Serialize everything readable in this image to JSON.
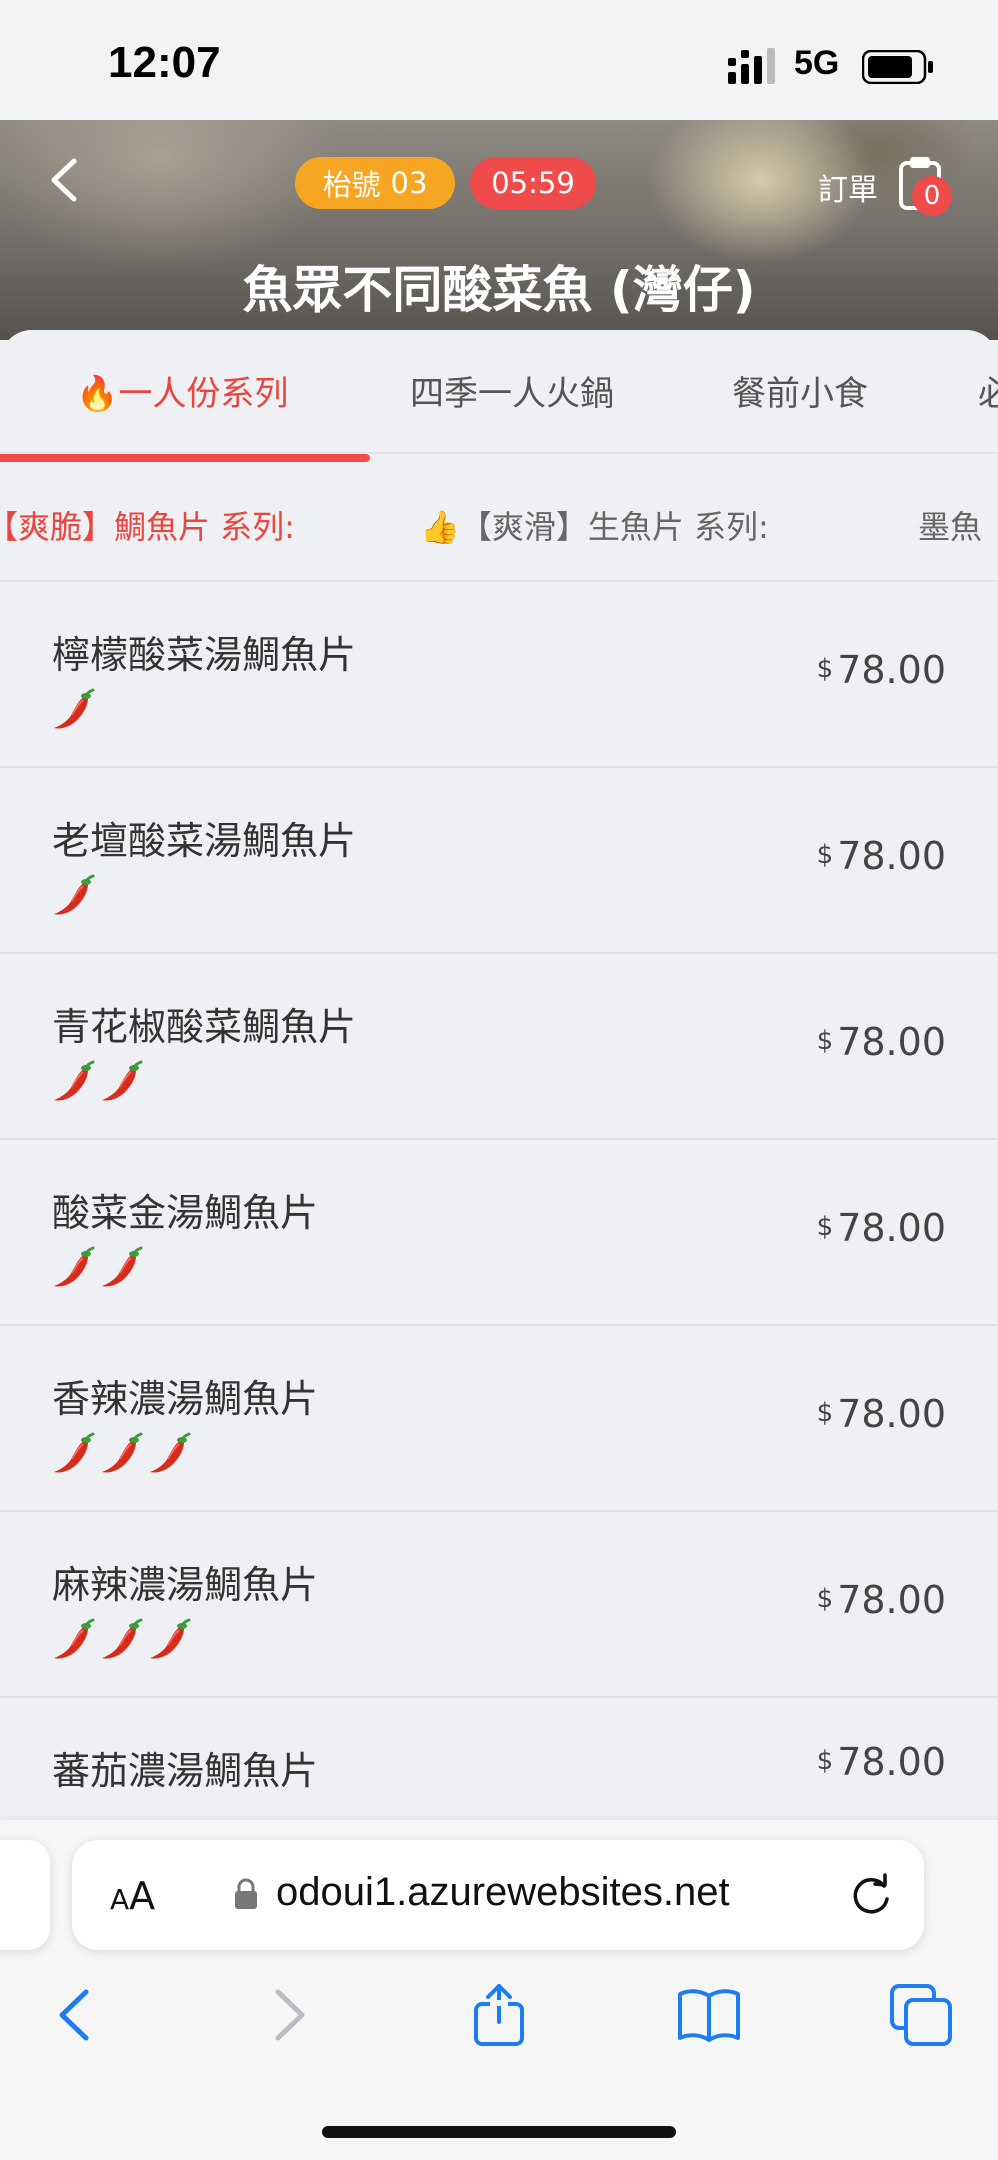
{
  "status_bar": {
    "time": "12:07",
    "network": "5G"
  },
  "header": {
    "table_label": "枱號",
    "table_number": "03",
    "timer": "05:59",
    "order_label": "訂單",
    "cart_count": "0",
    "store_name": "魚眾不同酸菜魚 (灣仔)"
  },
  "category_tabs": [
    {
      "label": "🔥一人份系列",
      "active": true
    },
    {
      "label": "四季一人火鍋"
    },
    {
      "label": "餐前小食"
    },
    {
      "label": "必"
    }
  ],
  "sub_tabs": [
    {
      "label": "【爽脆】鯛魚片 系列:",
      "active": true
    },
    {
      "label": "👍【爽滑】生魚片 系列:"
    },
    {
      "label": "墨魚"
    }
  ],
  "menu_items": [
    {
      "name": "檸檬酸菜湯鯛魚片",
      "spice_level": 1,
      "currency": "$",
      "price": "78.00"
    },
    {
      "name": "老壇酸菜湯鯛魚片",
      "spice_level": 1,
      "currency": "$",
      "price": "78.00"
    },
    {
      "name": "青花椒酸菜鯛魚片",
      "spice_level": 2,
      "currency": "$",
      "price": "78.00"
    },
    {
      "name": "酸菜金湯鯛魚片",
      "spice_level": 2,
      "currency": "$",
      "price": "78.00"
    },
    {
      "name": "香辣濃湯鯛魚片",
      "spice_level": 3,
      "currency": "$",
      "price": "78.00"
    },
    {
      "name": "麻辣濃湯鯛魚片",
      "spice_level": 3,
      "currency": "$",
      "price": "78.00"
    },
    {
      "name": "蕃茄濃湯鯛魚片",
      "spice_level": 0,
      "currency": "$",
      "price": "78.00"
    }
  ],
  "browser": {
    "aa_small": "A",
    "aa_large": "A",
    "url": "odoui1.azurewebsites.net"
  },
  "colors": {
    "accent": "#f04b4b",
    "badge_orange": "#f6a623",
    "safari_blue": "#1e7cf2"
  }
}
